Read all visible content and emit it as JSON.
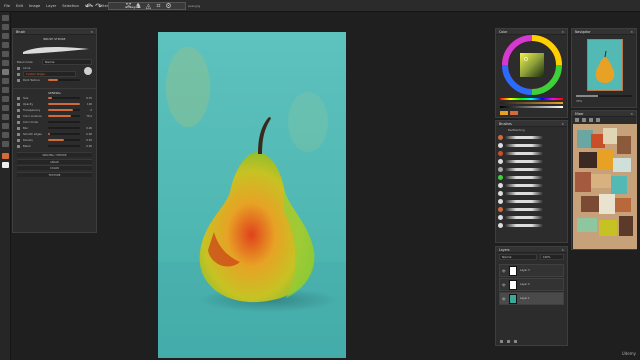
{
  "menubar": {
    "items": [
      "File",
      "Edit",
      "Image",
      "Layer",
      "Selection",
      "View",
      "Filters",
      "Window"
    ],
    "title": "ArtRage",
    "document": "pear.jpg"
  },
  "brush_panel": {
    "title": "Brush",
    "brush_stroke_label": "BRUSH STROKE",
    "mode_label": "Blend mode",
    "mode_value": "Normal",
    "shape_label": "Circle",
    "shape_sub": "Custom Shape",
    "texture_label": "Paint Texture",
    "section_general": "GENERAL",
    "rows": [
      {
        "label": "Size",
        "value": "6.70",
        "fill": 0.12
      },
      {
        "label": "Opacity",
        "value": "100",
        "fill": 1.0
      },
      {
        "label": "Transparency",
        "value": "0",
        "fill": 0.78
      },
      {
        "label": "Color variance",
        "value": "75.0",
        "fill": 0.72
      },
      {
        "label": "Color mode",
        "value": "",
        "fill": 0.0
      },
      {
        "label": "Blur",
        "value": "0.00",
        "fill": 0.0
      },
      {
        "label": "Smooth edges",
        "value": "0.00",
        "fill": 0.05
      },
      {
        "label": "Density",
        "value": "0.50",
        "fill": 0.5
      },
      {
        "label": "Bleed",
        "value": "0.00",
        "fill": 0.0
      }
    ],
    "collapsed": [
      "SPACING / STROKE",
      "ANGLE",
      "COLOR",
      "TEXTURE"
    ]
  },
  "color_panel": {
    "title": "Color"
  },
  "navigator_panel": {
    "title": "Navigator",
    "zoom": "33%"
  },
  "brushes_panel": {
    "title": "Brushes",
    "group": "BadPainting"
  },
  "mixer_panel": {
    "title": "Mixer"
  },
  "layers_panel": {
    "title": "Layers",
    "blend": "Normal",
    "opacity": "100%",
    "layers": [
      {
        "name": "Layer 3",
        "active": false,
        "thumb": "#ffffff"
      },
      {
        "name": "Layer 2",
        "active": false,
        "thumb": "#ffffff"
      },
      {
        "name": "Layer 1",
        "active": true,
        "thumb": "#3aa896"
      }
    ]
  },
  "watermark": "Udemy",
  "colors": {
    "accent": "#d26a3a",
    "background": "#1f1f1f",
    "panel": "#2c2c2c",
    "canvas_bg": "#4fb6b2"
  }
}
